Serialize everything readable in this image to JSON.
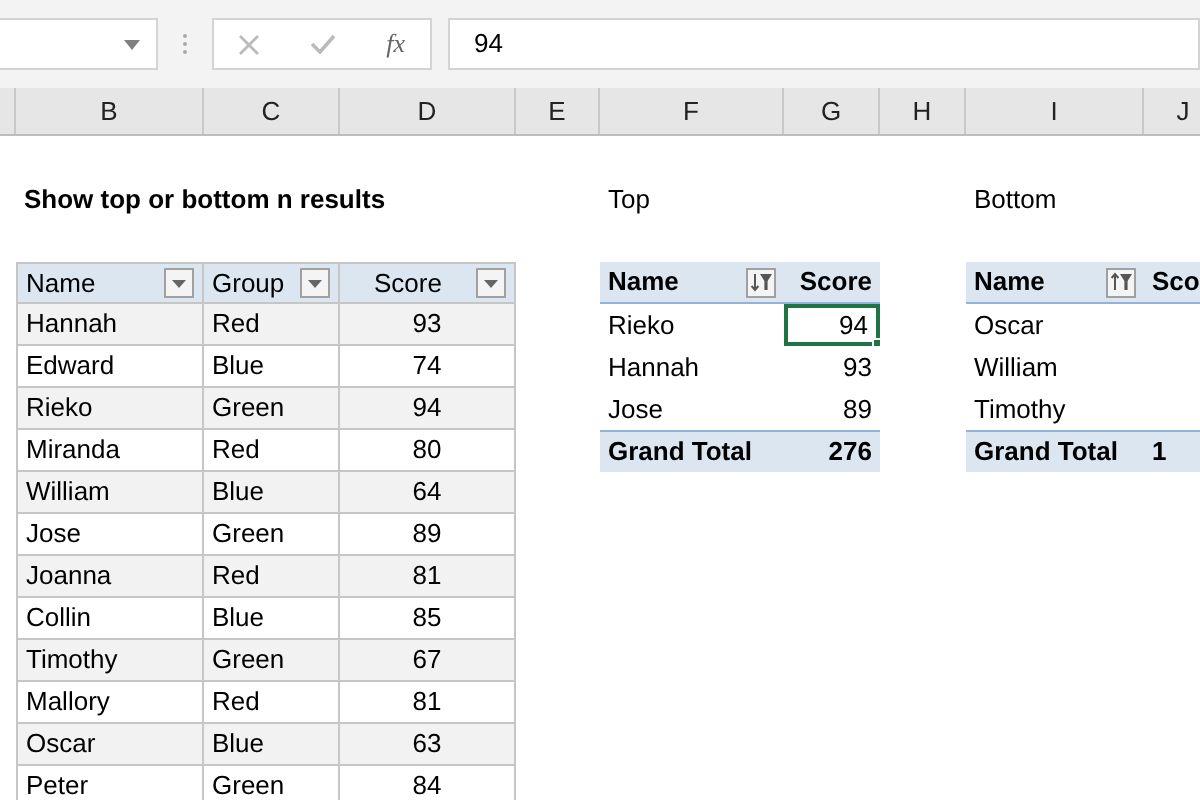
{
  "formula_bar": {
    "function_label": "fx",
    "value": "94"
  },
  "column_headers": [
    "B",
    "C",
    "D",
    "E",
    "F",
    "G",
    "H",
    "I",
    "J"
  ],
  "title": "Show top or bottom n results",
  "source_table": {
    "columns": [
      {
        "label": "Name",
        "kind": "text"
      },
      {
        "label": "Group",
        "kind": "text"
      },
      {
        "label": "Score",
        "kind": "number"
      }
    ],
    "rows": [
      [
        "Hannah",
        "Red",
        "93"
      ],
      [
        "Edward",
        "Blue",
        "74"
      ],
      [
        "Rieko",
        "Green",
        "94"
      ],
      [
        "Miranda",
        "Red",
        "80"
      ],
      [
        "William",
        "Blue",
        "64"
      ],
      [
        "Jose",
        "Green",
        "89"
      ],
      [
        "Joanna",
        "Red",
        "81"
      ],
      [
        "Collin",
        "Blue",
        "85"
      ],
      [
        "Timothy",
        "Green",
        "67"
      ],
      [
        "Mallory",
        "Red",
        "81"
      ],
      [
        "Oscar",
        "Blue",
        "63"
      ],
      [
        "Peter",
        "Green",
        "84"
      ]
    ]
  },
  "pivots": [
    {
      "label": "Top",
      "name_header": "Name",
      "score_header": "Score",
      "kind": "top",
      "rows": [
        {
          "name": "Rieko",
          "score": "94",
          "selected": true
        },
        {
          "name": "Hannah",
          "score": "93",
          "selected": false
        },
        {
          "name": "Jose",
          "score": "89",
          "selected": false
        }
      ],
      "total_label": "Grand Total",
      "total": "276"
    },
    {
      "label": "Bottom",
      "name_header": "Name",
      "score_header": "Sco",
      "kind": "bottom",
      "rows": [
        {
          "name": "Oscar",
          "selected": false
        },
        {
          "name": "William",
          "selected": false
        },
        {
          "name": "Timothy",
          "selected": false
        }
      ],
      "total_label": "Grand Total",
      "total": "1"
    }
  ]
}
